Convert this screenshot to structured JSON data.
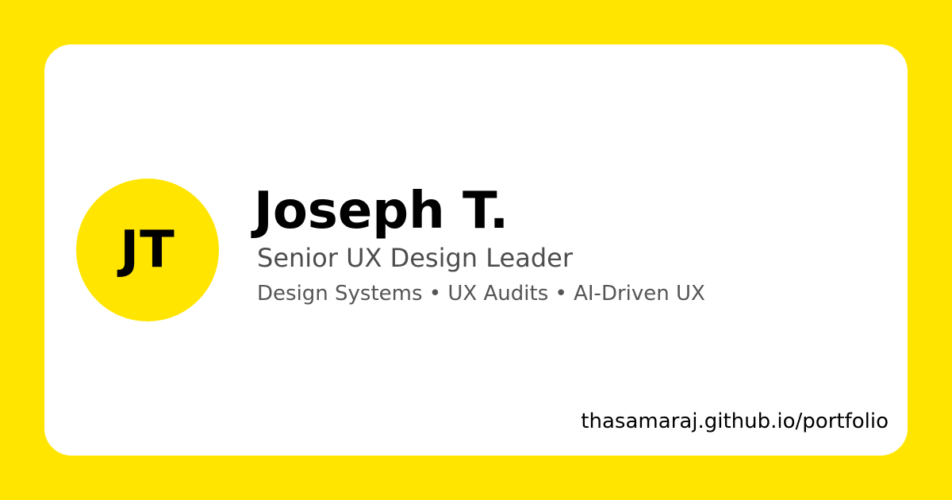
{
  "avatar": {
    "initials": "JT"
  },
  "profile": {
    "name": "Joseph T.",
    "title": "Senior UX Design Leader",
    "skills": "Design Systems • UX Audits • AI-Driven UX"
  },
  "footer": {
    "url": "thasamaraj.github.io/portfolio"
  },
  "colors": {
    "background": "#FFE500",
    "card": "#FFFFFF",
    "avatar": "#FFE500",
    "name_text": "#000000",
    "secondary_text": "#4D4D4D"
  }
}
